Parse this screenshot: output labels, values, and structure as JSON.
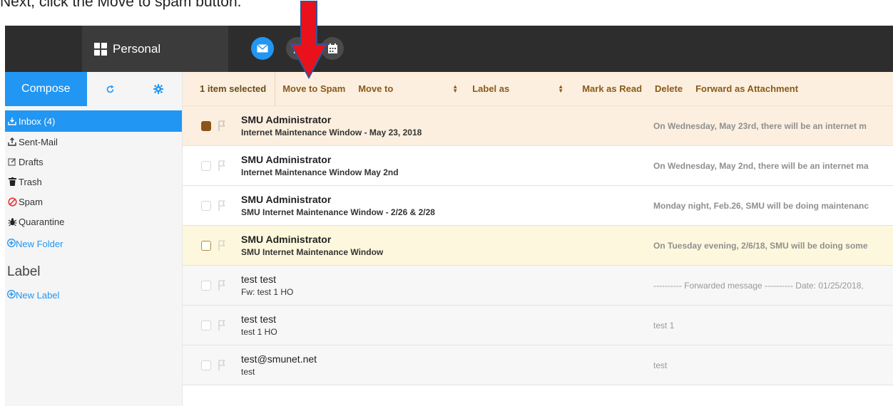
{
  "instruction": "Next, click the Move to spam button.",
  "header": {
    "account_label": "Personal",
    "apps": [
      {
        "icon": "mail-icon"
      },
      {
        "icon": "contacts-icon"
      },
      {
        "icon": "calendar-icon"
      }
    ]
  },
  "sidebar": {
    "compose_label": "Compose",
    "refresh_icon": "refresh-icon",
    "settings_icon": "gear-icon",
    "folders": [
      {
        "label": "Inbox (4)",
        "icon": "inbox-icon",
        "active": true
      },
      {
        "label": "Sent-Mail",
        "icon": "sent-icon",
        "active": false
      },
      {
        "label": "Drafts",
        "icon": "drafts-icon",
        "active": false
      },
      {
        "label": "Trash",
        "icon": "trash-icon",
        "active": false
      },
      {
        "label": "Spam",
        "icon": "spam-icon",
        "active": false
      },
      {
        "label": "Quarantine",
        "icon": "quarantine-icon",
        "active": false
      }
    ],
    "new_folder_label": "New Folder",
    "label_heading": "Label",
    "new_label_label": "New Label"
  },
  "actionbar": {
    "selected_count": "1 item selected",
    "move_to_spam": "Move to Spam",
    "move_to": "Move to",
    "label_as": "Label as",
    "mark_as_read": "Mark as Read",
    "delete": "Delete",
    "forward_as_attachment": "Forward as Attachment"
  },
  "messages": [
    {
      "sender": "SMU Administrator",
      "subject": "Internet Maintenance Window - May 23, 2018",
      "preview": "On Wednesday, May 23rd, there will be an internet m",
      "unread": true,
      "state": "selected"
    },
    {
      "sender": "SMU Administrator",
      "subject": "Internet Maintenance Window May 2nd",
      "preview": "On Wednesday, May 2nd, there will be an internet ma",
      "unread": true,
      "state": "normal"
    },
    {
      "sender": "SMU Administrator",
      "subject": "SMU Internet Maintenance Window - 2/26 & 2/28",
      "preview": "Monday night, Feb.26, SMU will be doing maintenanc",
      "unread": true,
      "state": "normal"
    },
    {
      "sender": "SMU Administrator",
      "subject": "SMU Internet Maintenance Window",
      "preview": "On Tuesday evening, 2/6/18, SMU will be doing some",
      "unread": true,
      "state": "highlight"
    },
    {
      "sender": "test test",
      "subject": "Fw: test 1 HO",
      "preview": "---------- Forwarded message ---------- Date: 01/25/2018,",
      "unread": false,
      "state": "read"
    },
    {
      "sender": "test test",
      "subject": "test 1 HO",
      "preview": "test 1",
      "unread": false,
      "state": "read"
    },
    {
      "sender": "test@smunet.net",
      "subject": "test",
      "preview": "test",
      "unread": false,
      "state": "read"
    }
  ],
  "colors": {
    "accent": "#2196f3",
    "topbar": "#2d2d2d",
    "actionbar_bg": "#fcefdf",
    "action_text": "#8a5a1a",
    "arrow_red": "#e8111c",
    "arrow_outline": "#2f5597"
  }
}
